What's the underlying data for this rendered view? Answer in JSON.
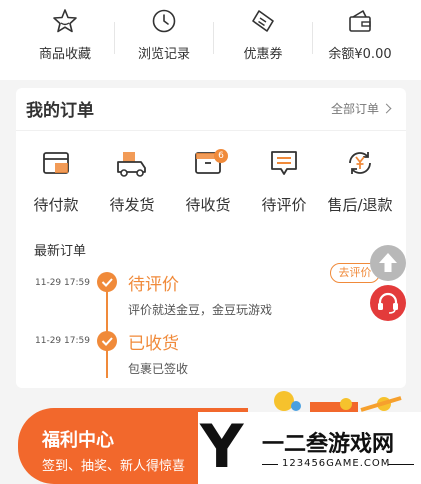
{
  "quick_links": [
    {
      "label": "商品收藏",
      "icon": "star-icon"
    },
    {
      "label": "浏览记录",
      "icon": "clock-icon"
    },
    {
      "label": "优惠券",
      "icon": "ticket-icon"
    },
    {
      "label": "余额¥0.00",
      "icon": "wallet-icon"
    }
  ],
  "orders": {
    "title": "我的订单",
    "all_link": "全部订单",
    "statuses": [
      {
        "label": "待付款",
        "icon": "card-icon"
      },
      {
        "label": "待发货",
        "icon": "delivery-icon"
      },
      {
        "label": "待收货",
        "icon": "box-icon",
        "badge": "6"
      },
      {
        "label": "待评价",
        "icon": "comment-icon"
      },
      {
        "label": "售后/退款",
        "icon": "refund-icon"
      }
    ],
    "recent_title": "最新订单",
    "timeline": [
      {
        "time": "11-29 17:59",
        "status": "待评价",
        "desc": "评价就送金豆，金豆玩游戏",
        "action": "去评价"
      },
      {
        "time": "11-29 17:59",
        "status": "已收货",
        "desc": "包裹已签收"
      }
    ]
  },
  "welfare": {
    "title": "福利中心",
    "subtitle": "签到、抽奖、新人得惊喜"
  },
  "watermark": {
    "letter": "Y",
    "name": "一二叁游戏网",
    "url": "123456GAME.COM"
  },
  "colors": {
    "accent": "#f08a3a",
    "banner": "#f2682c",
    "service": "#e33b3b"
  }
}
